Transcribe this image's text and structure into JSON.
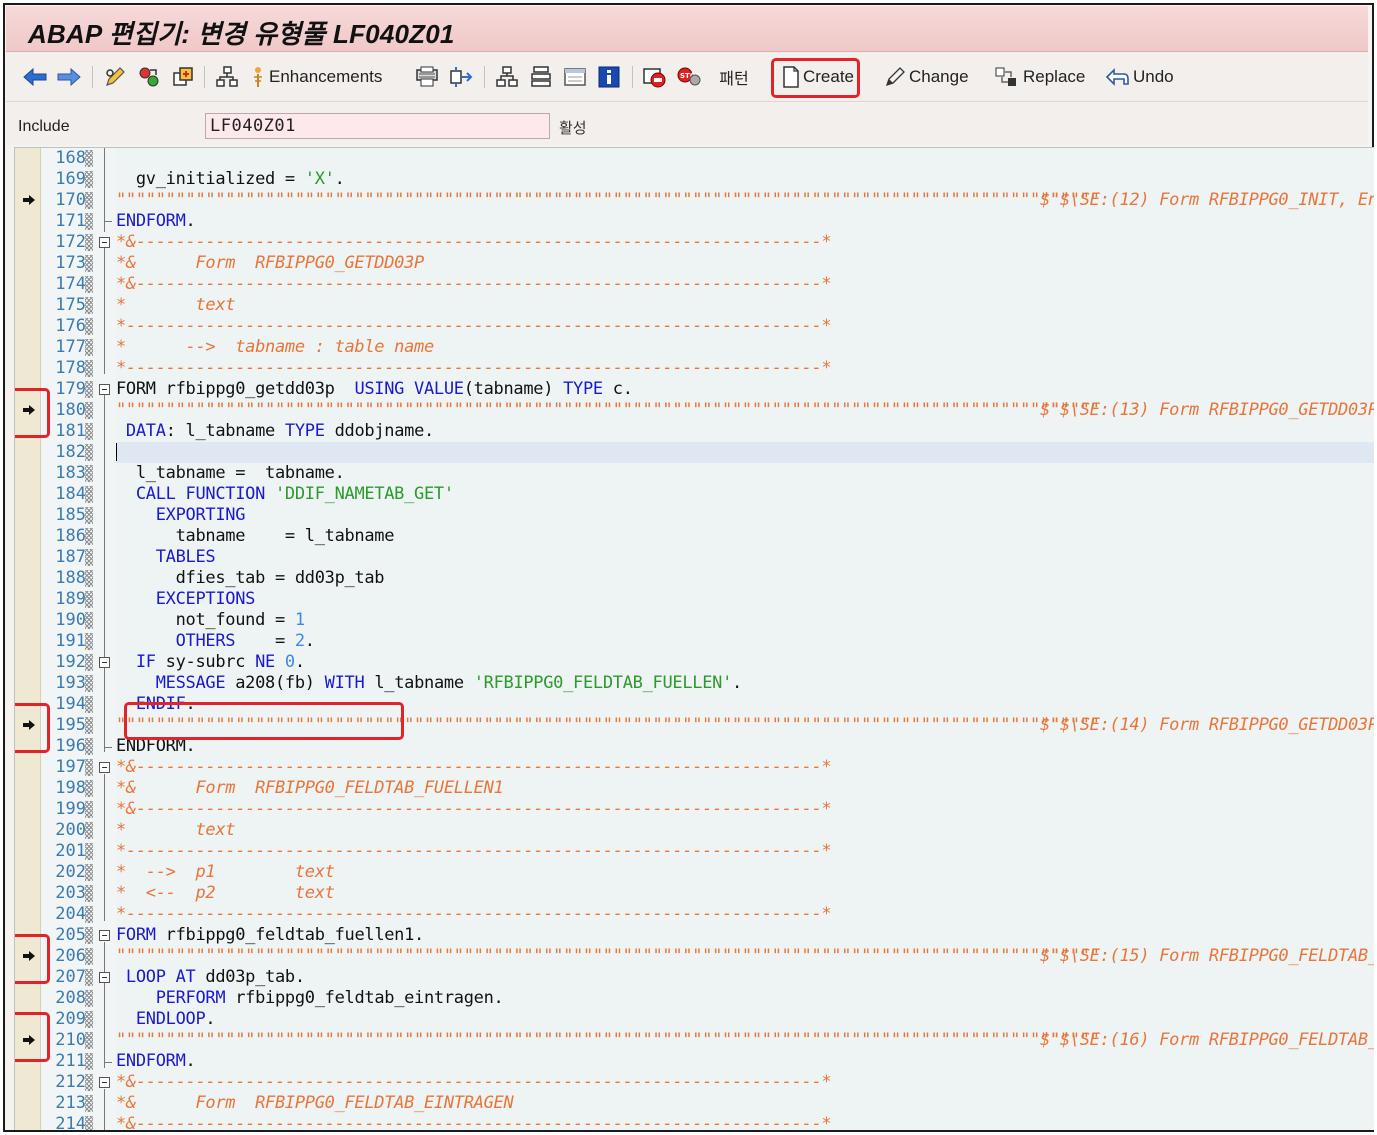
{
  "window": {
    "title": "ABAP 편집기: 변경 유형풀 LF040Z01"
  },
  "toolbar": {
    "enhancements": "Enhancements",
    "pattern": "패턴",
    "create": "Create",
    "change": "Change",
    "replace": "Replace",
    "undo": "Undo"
  },
  "include": {
    "label": "Include",
    "value": "LF040Z01",
    "status": "활성"
  },
  "colors": {
    "keyword": "#1a1acc",
    "string": "#2c9a2c",
    "number": "#3b8be0",
    "comment": "#e8753a",
    "highlight": "#e1232a"
  },
  "editor": {
    "lines": [
      {
        "n": "168"
      },
      {
        "n": "169"
      },
      {
        "n": "170"
      },
      {
        "n": "171"
      },
      {
        "n": "172"
      },
      {
        "n": "173"
      },
      {
        "n": "174"
      },
      {
        "n": "175"
      },
      {
        "n": "176"
      },
      {
        "n": "177"
      },
      {
        "n": "178"
      },
      {
        "n": "179"
      },
      {
        "n": "180"
      },
      {
        "n": "181"
      },
      {
        "n": "182"
      },
      {
        "n": "183"
      },
      {
        "n": "184"
      },
      {
        "n": "185"
      },
      {
        "n": "186"
      },
      {
        "n": "187"
      },
      {
        "n": "188"
      },
      {
        "n": "189"
      },
      {
        "n": "190"
      },
      {
        "n": "191"
      },
      {
        "n": "192"
      },
      {
        "n": "193"
      },
      {
        "n": "194"
      },
      {
        "n": "195"
      },
      {
        "n": "196"
      },
      {
        "n": "197"
      },
      {
        "n": "198"
      },
      {
        "n": "199"
      },
      {
        "n": "200"
      },
      {
        "n": "201"
      },
      {
        "n": "202"
      },
      {
        "n": "203"
      },
      {
        "n": "204"
      },
      {
        "n": "205"
      },
      {
        "n": "206"
      },
      {
        "n": "207"
      },
      {
        "n": "208"
      },
      {
        "n": "209"
      },
      {
        "n": "210"
      },
      {
        "n": "211"
      },
      {
        "n": "212"
      },
      {
        "n": "213"
      },
      {
        "n": "214"
      }
    ],
    "code": {
      "l169": {
        "a": "  gv_initialized = ",
        "b": "'X'",
        "c": "."
      },
      "l170": {
        "q": "\"\"\"\"\"\"\"\"\"\"\"\"\"\"\"\"\"\"\"\"\"\"\"\"\"\"\"\"\"\"\"\"\"\"\"\"\"\"\"\"\"\"\"\"\"\"\"\"\"\"\"\"\"\"\"\"\"\"\"\"\"\"\"\"\"\"\"\"\"\"\"\"\"\"\"\"\"\"\"\"\"\"\"\"\"\"\"\"\"\"\"\"\"\"\"\"\"\"\"",
        "m": "$\"$\\SE:(12) Form RFBIPPG0_INIT, En"
      },
      "l171": {
        "a": "ENDFORM",
        "b": "."
      },
      "l172": {
        "a": "*&---------------------------------------------------------------------*"
      },
      "l173": {
        "a": "*&      Form  RFBIPPG0_GETDD03P"
      },
      "l174": {
        "a": "*&---------------------------------------------------------------------*"
      },
      "l175": {
        "a": "*       text"
      },
      "l176": {
        "a": "*----------------------------------------------------------------------*"
      },
      "l177": {
        "a": "*      -->  tabname : table name"
      },
      "l178": {
        "a": "*----------------------------------------------------------------------*"
      },
      "l179": {
        "a": "FORM rfbippg0_getdd03p  ",
        "b": "USING VALUE",
        "c": "(tabname) ",
        "d": "TYPE",
        "e": " c."
      },
      "l180": {
        "q": "\"\"\"\"\"\"\"\"\"\"\"\"\"\"\"\"\"\"\"\"\"\"\"\"\"\"\"\"\"\"\"\"\"\"\"\"\"\"\"\"\"\"\"\"\"\"\"\"\"\"\"\"\"\"\"\"\"\"\"\"\"\"\"\"\"\"\"\"\"\"\"\"\"\"\"\"\"\"\"\"\"\"\"\"\"\"\"\"\"\"\"\"\"\"\"\"\"\"\"",
        "m": "$\"$\\SE:(13) Form RFBIPPG0_GETDD03P"
      },
      "l181": {
        "a": " DATA",
        "b": ": l_tabname ",
        "c": "TYPE",
        "d": " ddobjname."
      },
      "l183": {
        "a": "  l_tabname =  tabname."
      },
      "l184": {
        "a": "  CALL FUNCTION",
        "b": " ",
        "c": "'DDIF_NAMETAB_GET'"
      },
      "l185": {
        "a": "    EXPORTING"
      },
      "l186": {
        "a": "      tabname    = l_tabname"
      },
      "l187": {
        "a": "    TABLES"
      },
      "l188": {
        "a": "      dfies_tab = dd03p_tab"
      },
      "l189": {
        "a": "    EXCEPTIONS"
      },
      "l190": {
        "a": "      not_found = ",
        "b": "1"
      },
      "l191": {
        "a": "      OTHERS",
        "b": "    = ",
        "c": "2",
        "d": "."
      },
      "l192": {
        "a": "  IF",
        "b": " sy-subrc ",
        "c": "NE",
        "d": " ",
        "e": "0",
        "f": "."
      },
      "l193": {
        "a": "    MESSAGE",
        "b": " a208(fb) ",
        "c": "WITH",
        "d": " l_tabname ",
        "e": "'RFBIPPG0_FELDTAB_FUELLEN'",
        "f": "."
      },
      "l194": {
        "a": "  ENDIF",
        "b": "."
      },
      "l195": {
        "q": "\"\"\"\"\"\"\"\"\"\"\"\"\"\"\"\"\"\"\"\"\"\"\"\"\"\"\"\"\"\"\"\"\"\"\"\"\"\"\"\"\"\"\"\"\"\"\"\"\"\"\"\"\"\"\"\"\"\"\"\"\"\"\"\"\"\"\"\"\"\"\"\"\"\"\"\"\"\"\"\"\"\"\"\"\"\"\"\"\"\"\"\"\"\"\"\"\"\"\"",
        "m": "$\"$\\SE:(14) Form RFBIPPG0_GETDD03P"
      },
      "l196": {
        "a": "ENDFORM",
        "b": "."
      },
      "l197": {
        "a": "*&---------------------------------------------------------------------*"
      },
      "l198": {
        "a": "*&      Form  RFBIPPG0_FELDTAB_FUELLEN1"
      },
      "l199": {
        "a": "*&---------------------------------------------------------------------*"
      },
      "l200": {
        "a": "*       text"
      },
      "l201": {
        "a": "*----------------------------------------------------------------------*"
      },
      "l202": {
        "a": "*  -->  p1        text"
      },
      "l203": {
        "a": "*  <--  p2        text"
      },
      "l204": {
        "a": "*----------------------------------------------------------------------*"
      },
      "l205": {
        "a": "FORM",
        "b": " rfbippg0_feldtab_fuellen1."
      },
      "l206": {
        "q": "\"\"\"\"\"\"\"\"\"\"\"\"\"\"\"\"\"\"\"\"\"\"\"\"\"\"\"\"\"\"\"\"\"\"\"\"\"\"\"\"\"\"\"\"\"\"\"\"\"\"\"\"\"\"\"\"\"\"\"\"\"\"\"\"\"\"\"\"\"\"\"\"\"\"\"\"\"\"\"\"\"\"\"\"\"\"\"\"\"\"\"\"\"\"\"\"\"\"\"",
        "m": "$\"$\\SE:(15) Form RFBIPPG0_FELDTAB_"
      },
      "l207": {
        "a": " LOOP AT",
        "b": " dd03p_tab."
      },
      "l208": {
        "a": "    PERFORM",
        "b": " rfbippg0_feldtab_eintragen."
      },
      "l209": {
        "a": "  ENDLOOP",
        "b": "."
      },
      "l210": {
        "q": "\"\"\"\"\"\"\"\"\"\"\"\"\"\"\"\"\"\"\"\"\"\"\"\"\"\"\"\"\"\"\"\"\"\"\"\"\"\"\"\"\"\"\"\"\"\"\"\"\"\"\"\"\"\"\"\"\"\"\"\"\"\"\"\"\"\"\"\"\"\"\"\"\"\"\"\"\"\"\"\"\"\"\"\"\"\"\"\"\"\"\"\"\"\"\"\"\"\"\"",
        "m": "$\"$\\SE:(16) Form RFBIPPG0_FELDTAB_"
      },
      "l211": {
        "a": "ENDFORM",
        "b": "."
      },
      "l212": {
        "a": "*&---------------------------------------------------------------------*"
      },
      "l213": {
        "a": "*&      Form  RFBIPPG0_FELDTAB_EINTRAGEN"
      },
      "l214": {
        "a": "*&---------------------------------------------------------------------*"
      }
    }
  }
}
